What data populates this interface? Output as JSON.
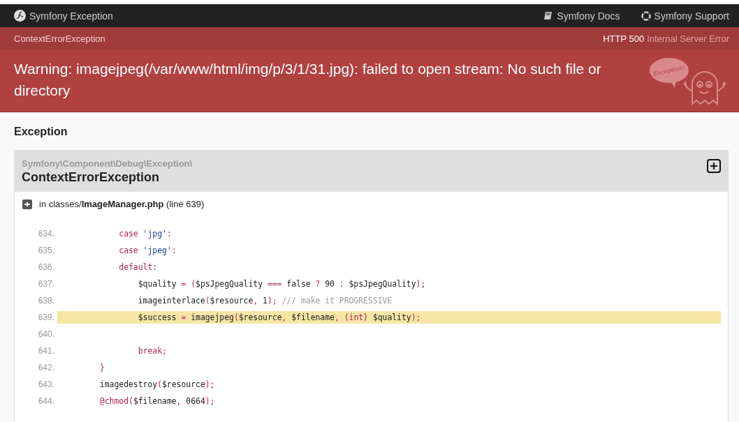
{
  "navbar": {
    "brand": "Symfony Exception",
    "links": [
      {
        "kind": "docs",
        "label": "Symfony Docs"
      },
      {
        "kind": "support",
        "label": "Symfony Support"
      }
    ]
  },
  "subheader": {
    "exception_class": "ContextErrorException",
    "status_code": "HTTP 500",
    "status_text": "Internal Server Error"
  },
  "header": {
    "message": "Warning: imagejpeg(/var/www/html/img/p/3/1/31.jpg): failed to open stream: No such file or directory",
    "mascot_bubble": "Exception!"
  },
  "section_title": "Exception",
  "exception": {
    "namespace": "Symfony\\Component\\Debug\\Exception\\",
    "class": "ContextErrorException",
    "expanded": true,
    "location": "in classes/**ImageManager.php** (line 639)",
    "lines": [
      {
        "number": "634.",
        "selected": false,
        "tokens": [
          {
            "kind": "keyword",
            "text": "            case "
          },
          {
            "kind": "string",
            "text": "'jpg'"
          },
          {
            "kind": "keyword",
            "text": ":"
          }
        ]
      },
      {
        "number": "635.",
        "selected": false,
        "tokens": [
          {
            "kind": "keyword",
            "text": "            case "
          },
          {
            "kind": "string",
            "text": "'jpeg'"
          },
          {
            "kind": "keyword",
            "text": ":"
          }
        ]
      },
      {
        "number": "636.",
        "selected": false,
        "tokens": [
          {
            "kind": "keyword",
            "text": "            default:"
          }
        ]
      },
      {
        "number": "637.",
        "selected": false,
        "tokens": [
          {
            "kind": "plain",
            "text": "                $quality "
          },
          {
            "kind": "keyword",
            "text": "= ("
          },
          {
            "kind": "plain",
            "text": "$psJpegQuality "
          },
          {
            "kind": "keyword",
            "text": "=== "
          },
          {
            "kind": "plain",
            "text": "false "
          },
          {
            "kind": "keyword",
            "text": "? "
          },
          {
            "kind": "plain",
            "text": "90 "
          },
          {
            "kind": "keyword",
            "text": ": "
          },
          {
            "kind": "plain",
            "text": "$psJpegQuality"
          },
          {
            "kind": "keyword",
            "text": ");"
          }
        ]
      },
      {
        "number": "638.",
        "selected": false,
        "tokens": [
          {
            "kind": "plain",
            "text": "                imageinterlace"
          },
          {
            "kind": "keyword",
            "text": "("
          },
          {
            "kind": "plain",
            "text": "$resource"
          },
          {
            "kind": "keyword",
            "text": ", "
          },
          {
            "kind": "plain",
            "text": "1"
          },
          {
            "kind": "keyword",
            "text": "); "
          },
          {
            "kind": "comment",
            "text": "/// make it PROGRESSIVE"
          }
        ]
      },
      {
        "number": "639.",
        "selected": true,
        "tokens": [
          {
            "kind": "plain",
            "text": "                $success "
          },
          {
            "kind": "keyword",
            "text": "= "
          },
          {
            "kind": "plain",
            "text": "imagejpeg"
          },
          {
            "kind": "keyword",
            "text": "("
          },
          {
            "kind": "plain",
            "text": "$resource"
          },
          {
            "kind": "keyword",
            "text": ", "
          },
          {
            "kind": "plain",
            "text": "$filename"
          },
          {
            "kind": "keyword",
            "text": ", (int) "
          },
          {
            "kind": "plain",
            "text": "$quality"
          },
          {
            "kind": "keyword",
            "text": ");"
          }
        ]
      },
      {
        "number": "640.",
        "selected": false
      },
      {
        "number": "641.",
        "selected": false,
        "tokens": [
          {
            "kind": "keyword",
            "text": "                break;"
          }
        ]
      },
      {
        "number": "642.",
        "selected": false,
        "tokens": [
          {
            "kind": "keyword",
            "text": "        }"
          }
        ]
      },
      {
        "number": "643.",
        "selected": false,
        "tokens": [
          {
            "kind": "plain",
            "text": "        imagedestroy"
          },
          {
            "kind": "keyword",
            "text": "("
          },
          {
            "kind": "plain",
            "text": "$resource"
          },
          {
            "kind": "keyword",
            "text": ");"
          }
        ]
      },
      {
        "number": "644.",
        "selected": false,
        "tokens": [
          {
            "kind": "keyword",
            "text": "        @chmod("
          },
          {
            "kind": "plain",
            "text": "$filename"
          },
          {
            "kind": "keyword",
            "text": ", "
          },
          {
            "kind": "plain",
            "text": "0664"
          },
          {
            "kind": "keyword",
            "text": ");"
          }
        ]
      }
    ]
  }
}
